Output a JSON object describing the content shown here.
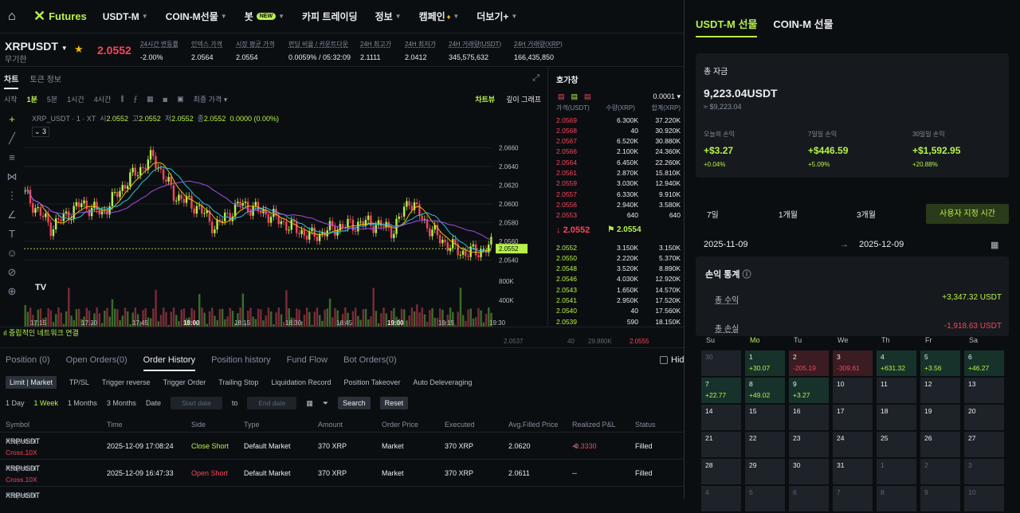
{
  "nav": {
    "logo": "Futures",
    "items": [
      "USDT-M",
      "COIN-M선물",
      "봇",
      "카피 트레이딩",
      "정보",
      "캠페인",
      "더보기+"
    ],
    "badge": "NEW"
  },
  "ticker": {
    "symbol": "XRPUSDT",
    "sub": "무기한",
    "price": "2.0552",
    "stats": [
      {
        "label": "24시간 변동률",
        "value": "-2.00%",
        "color": "red"
      },
      {
        "label": "인덱스 가격",
        "value": "2.0564"
      },
      {
        "label": "시장 평균 가격",
        "value": "2.0554"
      },
      {
        "label": "펀딩 비율 / 카운트다운",
        "value": "0.0059% / 05:32:09",
        "color": "green"
      },
      {
        "label": "24H 최고가",
        "value": "2.1111"
      },
      {
        "label": "24H 최저가",
        "value": "2.0412"
      },
      {
        "label": "24H 거래량(USDT)",
        "value": "345,575,632"
      },
      {
        "label": "24H 거래량(XRP)",
        "value": "166,435,850"
      }
    ]
  },
  "chart": {
    "tabs": [
      "차트",
      "토큰 정보"
    ],
    "toolbar": [
      "시작",
      "1분",
      "5분",
      "1시간",
      "4시간"
    ],
    "price_type": "최종 가격",
    "right_tabs": [
      "차트뷰",
      "깊이 그래프"
    ],
    "legend": {
      "title": "XRP_USDT · 1 · XT",
      "o": "2.0552",
      "h": "2.0552",
      "l": "2.0552",
      "c": "2.0552",
      "chg": "0.0000 (0.00%)",
      "count": "3"
    },
    "price_ticks": [
      "2.0660",
      "2.0640",
      "2.0620",
      "2.0600",
      "2.0580",
      "2.0560",
      "2.0540"
    ],
    "vol_ticks": [
      "800K",
      "400K"
    ],
    "time_ticks": [
      "17:15",
      "17:30",
      "17:45",
      "18:00",
      "18:15",
      "18:30",
      "18:45",
      "19:00",
      "19:15",
      "19:30"
    ],
    "last_price": "2.0552"
  },
  "chart_data": {
    "type": "candlestick",
    "x_range": [
      "17:10",
      "19:32"
    ],
    "y_range": [
      2.053,
      2.0668
    ],
    "last": 2.0552,
    "volume_max": "800K"
  },
  "orderbook": {
    "title": "호가창",
    "tick": "0.0001",
    "headers": [
      "가격(USDT)",
      "수량(XRP)",
      "합계(XRP)"
    ],
    "asks": [
      [
        "2.0569",
        "6.300K",
        "37.220K"
      ],
      [
        "2.0568",
        "40",
        "30.920K"
      ],
      [
        "2.0567",
        "6.520K",
        "30.880K"
      ],
      [
        "2.0566",
        "2.100K",
        "24.360K"
      ],
      [
        "2.0564",
        "6.450K",
        "22.260K"
      ],
      [
        "2.0561",
        "2.870K",
        "15.810K"
      ],
      [
        "2.0559",
        "3.030K",
        "12.940K"
      ],
      [
        "2.0557",
        "6.330K",
        "9.910K"
      ],
      [
        "2.0556",
        "2.940K",
        "3.580K"
      ],
      [
        "2.0553",
        "640",
        "640"
      ]
    ],
    "mid": "2.0552",
    "mark": "2.0554",
    "bids": [
      [
        "2.0552",
        "3.150K",
        "3.150K"
      ],
      [
        "2.0550",
        "2.220K",
        "5.370K"
      ],
      [
        "2.0548",
        "3.520K",
        "8.890K"
      ],
      [
        "2.0546",
        "4.030K",
        "12.920K"
      ],
      [
        "2.0543",
        "1.650K",
        "14.570K"
      ],
      [
        "2.0541",
        "2.950K",
        "17.520K"
      ],
      [
        "2.0540",
        "40",
        "17.560K"
      ],
      [
        "2.0539",
        "590",
        "18.150K"
      ]
    ]
  },
  "status": "중립적인 네트워크 연결",
  "ghost": [
    "2.0537",
    "40",
    "29.880K",
    "2.0555"
  ],
  "bottom": {
    "tabs": [
      "Position (0)",
      "Open Orders(0)",
      "Order History",
      "Position history",
      "Fund Flow",
      "Bot Orders(0)"
    ],
    "hide": "Hide",
    "subtabs": [
      "Limit | Market",
      "TP/SL",
      "Trigger reverse",
      "Trigger Order",
      "Trailing Stop",
      "Liquidation Record",
      "Position Takeover",
      "Auto Deleveraging"
    ],
    "filters": [
      "1 Day",
      "1 Week",
      "1 Months",
      "3 Months"
    ],
    "date_label": "Date",
    "start": "Start date",
    "to": "to",
    "end": "End date",
    "search": "Search",
    "reset": "Reset",
    "headers": [
      "Symbol",
      "Time",
      "Side",
      "Type",
      "Amount",
      "Order Price",
      "Executed",
      "Avg.Filled Price",
      "Realized P&L",
      "Status"
    ],
    "rows": [
      {
        "symbol": "XRPUSDT",
        "type_sub": "Perpetual",
        "margin": "Cross.10X",
        "time": "2025-12-09 17:08:24",
        "side": "Close Short",
        "otype": "Default Market",
        "amount": "370 XRP",
        "price": "Market",
        "executed": "370 XRP",
        "avg": "2.0620",
        "pnl": "-0.3330",
        "status": "Filled"
      },
      {
        "symbol": "XRPUSDT",
        "type_sub": "Perpetual",
        "margin": "Cross.10X",
        "time": "2025-12-09 16:47:33",
        "side": "Open Short",
        "otype": "Default Market",
        "amount": "370 XRP",
        "price": "Market",
        "executed": "370 XRP",
        "avg": "2.0611",
        "pnl": "--",
        "status": "Filled"
      },
      {
        "symbol": "XRPUSDT",
        "type_sub": "Perpetual"
      }
    ]
  },
  "right": {
    "tabs": [
      "USDT-M 선물",
      "COIN-M 선물"
    ],
    "total": {
      "title": "총 자금",
      "amount": "9,223.04USDT",
      "approx": "≈ $9,223.04",
      "cols": [
        {
          "label": "오늘의 손익",
          "value": "+$3.27",
          "pct": "+0.04%"
        },
        {
          "label": "7일일 손익",
          "value": "+$446.59",
          "pct": "+5.09%"
        },
        {
          "label": "30일일 손익",
          "value": "+$1,592.95",
          "pct": "+20.88%"
        }
      ]
    },
    "periods": [
      "7일",
      "1개월",
      "3개월",
      "사용자 지정 시간"
    ],
    "dates": {
      "from": "2025-11-09",
      "to": "2025-12-09"
    },
    "pnl": {
      "title": "손익 통계",
      "income_l": "총 수익",
      "income_v": "+3,347.32 USDT",
      "loss_l": "총 손실",
      "loss_v": "-1,918.63 USDT"
    },
    "dow": [
      "Su",
      "Mo",
      "Tu",
      "We",
      "Th",
      "Fr",
      "Sa"
    ],
    "calendar": [
      [
        "30",
        ""
      ],
      [
        "1",
        "+30.07"
      ],
      [
        "2",
        "-205.19"
      ],
      [
        "3",
        "-309.61"
      ],
      [
        "4",
        "+631.32"
      ],
      [
        "5",
        "+3.56"
      ],
      [
        "6",
        "+46.27"
      ],
      [
        "7",
        "+22.77"
      ],
      [
        "8",
        "+49.02"
      ],
      [
        "9",
        "+3.27"
      ],
      [
        "10",
        ""
      ],
      [
        "11",
        ""
      ],
      [
        "12",
        ""
      ],
      [
        "13",
        ""
      ],
      [
        "14",
        ""
      ],
      [
        "15",
        ""
      ],
      [
        "16",
        ""
      ],
      [
        "17",
        ""
      ],
      [
        "18",
        ""
      ],
      [
        "19",
        ""
      ],
      [
        "20",
        ""
      ],
      [
        "21",
        ""
      ],
      [
        "22",
        ""
      ],
      [
        "23",
        ""
      ],
      [
        "24",
        ""
      ],
      [
        "25",
        ""
      ],
      [
        "26",
        ""
      ],
      [
        "27",
        ""
      ],
      [
        "28",
        ""
      ],
      [
        "29",
        ""
      ],
      [
        "30",
        ""
      ],
      [
        "31",
        ""
      ],
      [
        "1",
        ""
      ],
      [
        "2",
        ""
      ],
      [
        "3",
        ""
      ],
      [
        "4",
        ""
      ],
      [
        "5",
        ""
      ],
      [
        "6",
        ""
      ],
      [
        "7",
        ""
      ],
      [
        "8",
        ""
      ],
      [
        "9",
        ""
      ],
      [
        "10",
        ""
      ]
    ]
  }
}
